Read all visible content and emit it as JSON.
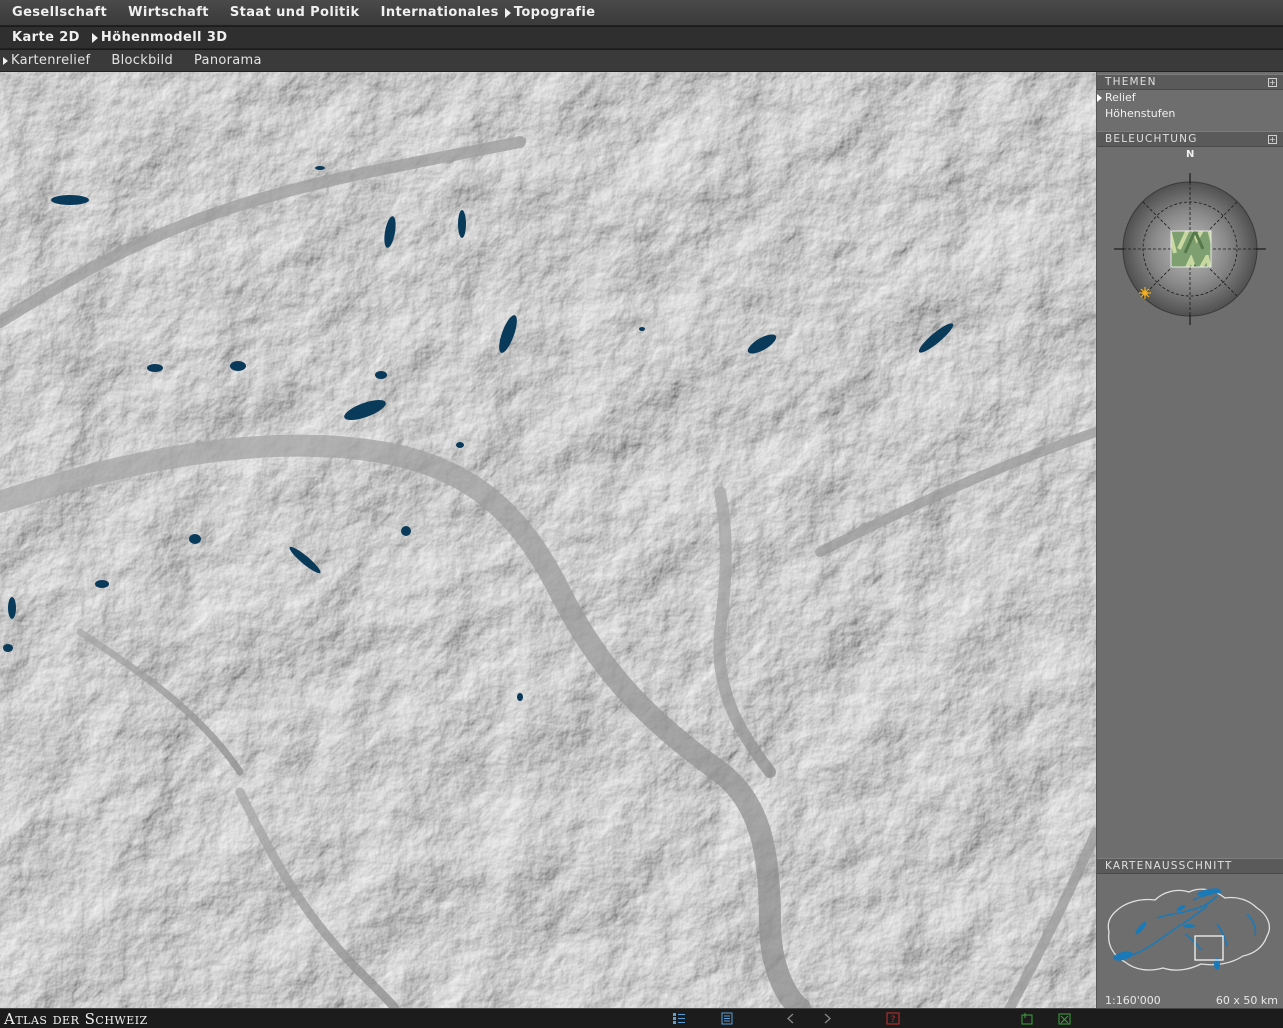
{
  "nav_main": {
    "items": [
      "Gesellschaft",
      "Wirtschaft",
      "Staat und Politik",
      "Internationales",
      "Topografie"
    ],
    "active": "Topografie"
  },
  "nav_sub": {
    "items": [
      "Karte 2D",
      "Höhenmodell 3D"
    ],
    "active": "Höhenmodell 3D"
  },
  "nav_view": {
    "items": [
      "Kartenrelief",
      "Blockbild",
      "Panorama"
    ],
    "active": "Kartenrelief"
  },
  "panel": {
    "themes_header": "THEMEN",
    "themes": [
      "Relief",
      "Höhenstufen"
    ],
    "active_theme": "Relief",
    "lighting_header": "BELEUCHTUNG",
    "compass_north": "N",
    "map_section_header": "KARTENAUSSCHNITT",
    "scale": "1:160'000",
    "area": "60 x 50 km"
  },
  "footer": {
    "app_title": "Atlas der Schweiz",
    "icons": [
      "legend-icon",
      "document-icon",
      "back-arrow-icon",
      "forward-arrow-icon",
      "help-icon",
      "print-icon",
      "export-icon"
    ]
  },
  "colors": {
    "lake": "#0a3a5a",
    "accent_green": "#3ea43e",
    "accent_red": "#c83030",
    "sun": "#f0b020",
    "minimap_water": "#1a7ab8"
  }
}
